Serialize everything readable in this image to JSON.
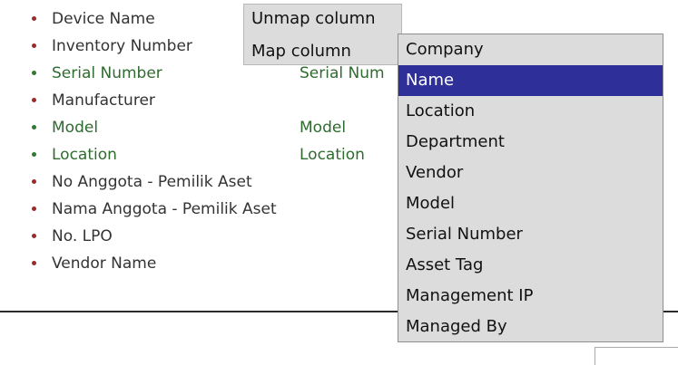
{
  "fields": [
    {
      "name": "Device Name",
      "mapped": false,
      "mapped_to": ""
    },
    {
      "name": "Inventory Number",
      "mapped": false,
      "mapped_to": ""
    },
    {
      "name": "Serial Number",
      "mapped": true,
      "mapped_to": "Serial Num"
    },
    {
      "name": "Manufacturer",
      "mapped": false,
      "mapped_to": ""
    },
    {
      "name": "Model",
      "mapped": true,
      "mapped_to": "Model"
    },
    {
      "name": "Location",
      "mapped": true,
      "mapped_to": "Location"
    },
    {
      "name": "No Anggota - Pemilik Aset",
      "mapped": false,
      "mapped_to": ""
    },
    {
      "name": "Nama Anggota - Pemilik Aset",
      "mapped": false,
      "mapped_to": ""
    },
    {
      "name": "No. LPO",
      "mapped": false,
      "mapped_to": ""
    },
    {
      "name": "Vendor Name",
      "mapped": false,
      "mapped_to": ""
    }
  ],
  "context_menu": {
    "unmap_label": "Unmap column",
    "map_label": "Map column"
  },
  "submenu": {
    "items": [
      {
        "label": "Company",
        "selected": false
      },
      {
        "label": "Name",
        "selected": true
      },
      {
        "label": "Location",
        "selected": false
      },
      {
        "label": "Department",
        "selected": false
      },
      {
        "label": "Vendor",
        "selected": false
      },
      {
        "label": "Model",
        "selected": false
      },
      {
        "label": "Serial Number",
        "selected": false
      },
      {
        "label": "Asset Tag",
        "selected": false
      },
      {
        "label": "Management IP",
        "selected": false
      },
      {
        "label": "Managed By",
        "selected": false
      }
    ]
  },
  "colors": {
    "unmapped_bullet": "#9b2b2b",
    "mapped_bullet": "#2f7a2f",
    "mapped_text": "#2f6b2f",
    "menu_background": "#dcdcdc",
    "selected_background": "#2f2f99",
    "selected_text": "#ffffff"
  }
}
